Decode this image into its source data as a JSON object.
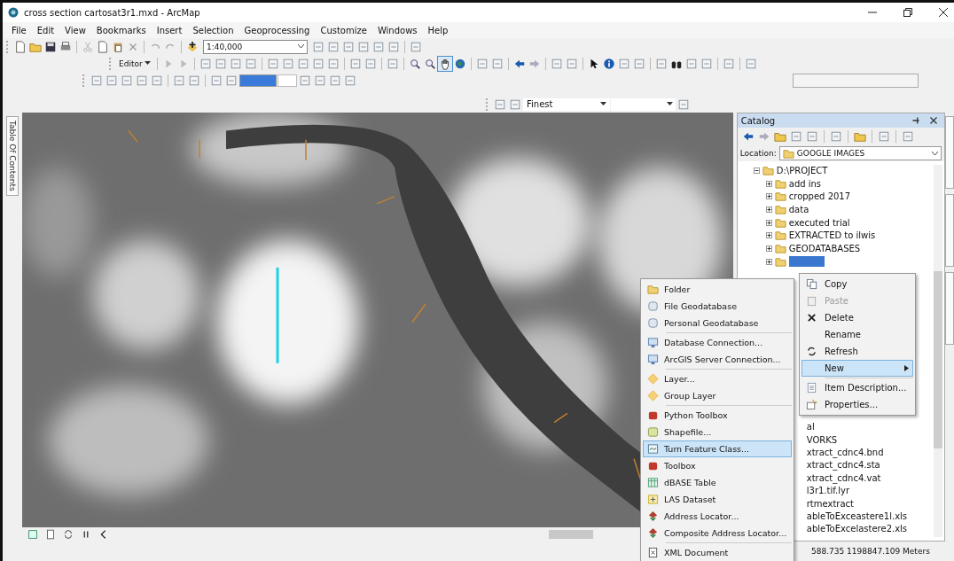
{
  "window": {
    "title": "cross section cartosat3r1.mxd - ArcMap"
  },
  "menu_bar": [
    "File",
    "Edit",
    "View",
    "Bookmarks",
    "Insert",
    "Selection",
    "Geoprocessing",
    "Customize",
    "Windows",
    "Help"
  ],
  "toolbar": {
    "scale": "1:40,000",
    "editor": "Editor",
    "resolution": "Finest"
  },
  "toc_tab": {
    "label": "Table Of Contents"
  },
  "catalog": {
    "title": "Catalog",
    "location_label": "Location:",
    "location": "GOOGLE IMAGES",
    "tree": [
      {
        "label": "D:\\PROJECT",
        "kind": "folder",
        "expanded": true,
        "children": [
          {
            "label": "add ins",
            "kind": "folder",
            "expanded": false,
            "selected": false
          },
          {
            "label": "cropped 2017",
            "kind": "folder",
            "expanded": false,
            "selected": false
          },
          {
            "label": "data",
            "kind": "folder",
            "expanded": false,
            "selected": false
          },
          {
            "label": "executed trial",
            "kind": "folder",
            "expanded": false,
            "selected": false
          },
          {
            "label": "EXTRACTED to ilwis",
            "kind": "folder",
            "expanded": false,
            "selected": false
          },
          {
            "label": "GEODATABASES",
            "kind": "folder",
            "expanded": false,
            "selected": false
          },
          {
            "kind": "folder",
            "expanded": false,
            "selected": true
          }
        ]
      }
    ],
    "clipped_rows": [
      "al",
      "VORKS",
      "xtract_cdnc4.bnd",
      "xtract_cdnc4.sta",
      "xtract_cdnc4.vat",
      "l3r1.tif.lyr",
      "rtmextract",
      "ableToExceastere1l.xls",
      "ableToExcelastere2.xls"
    ]
  },
  "context_menu": [
    {
      "label": "Copy",
      "kind": "copy",
      "disabled": false,
      "selected": false,
      "submenu": false
    },
    {
      "label": "Paste",
      "kind": "paste",
      "disabled": true,
      "selected": false,
      "submenu": false
    },
    {
      "label": "Delete",
      "kind": "delete",
      "disabled": false,
      "selected": false,
      "submenu": false
    },
    {
      "label": "Rename",
      "kind": "none",
      "disabled": false,
      "selected": false,
      "submenu": false
    },
    {
      "label": "Refresh",
      "kind": "refresh",
      "disabled": false,
      "selected": false,
      "submenu": false
    },
    {
      "label": "New",
      "kind": "none",
      "disabled": false,
      "selected": true,
      "submenu": true
    },
    {
      "label": "Item Description...",
      "kind": "document",
      "disabled": false,
      "selected": false,
      "submenu": false
    },
    {
      "label": "Properties...",
      "kind": "properties",
      "disabled": false,
      "selected": false,
      "submenu": false
    }
  ],
  "new_submenu": [
    {
      "label": "Folder",
      "kind": "folder",
      "selected": false,
      "separator_after": false
    },
    {
      "label": "File Geodatabase",
      "kind": "database",
      "selected": false,
      "separator_after": false
    },
    {
      "label": "Personal Geodatabase",
      "kind": "database",
      "selected": false,
      "separator_after": true
    },
    {
      "label": "Database Connection...",
      "kind": "server",
      "selected": false,
      "separator_after": false
    },
    {
      "label": "ArcGIS Server Connection...",
      "kind": "server",
      "selected": false,
      "separator_after": true
    },
    {
      "label": "Layer...",
      "kind": "layer",
      "selected": false,
      "separator_after": false
    },
    {
      "label": "Group Layer",
      "kind": "layer",
      "selected": false,
      "separator_after": true
    },
    {
      "label": "Python Toolbox",
      "kind": "toolbox",
      "selected": false,
      "separator_after": false
    },
    {
      "label": "Shapefile...",
      "kind": "shapefile",
      "selected": false,
      "separator_after": false
    },
    {
      "label": "Turn Feature Class...",
      "kind": "feature",
      "selected": true,
      "separator_after": false
    },
    {
      "label": "Toolbox",
      "kind": "toolbox",
      "selected": false,
      "separator_after": false
    },
    {
      "label": "dBASE Table",
      "kind": "table",
      "selected": false,
      "separator_after": false
    },
    {
      "label": "LAS Dataset",
      "kind": "dataset",
      "selected": false,
      "separator_after": false
    },
    {
      "label": "Address Locator...",
      "kind": "locator",
      "selected": false,
      "separator_after": false
    },
    {
      "label": "Composite Address Locator...",
      "kind": "locator",
      "selected": false,
      "separator_after": true
    },
    {
      "label": "XML Document",
      "kind": "xml",
      "selected": false,
      "separator_after": false
    }
  ],
  "status_bar": {
    "coordinates": "588.735 1198847.109 Meters"
  }
}
